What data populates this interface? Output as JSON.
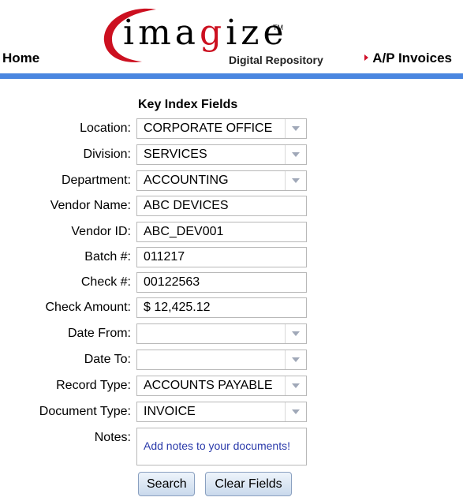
{
  "header": {
    "home": "Home",
    "logo_word_a": "ima",
    "logo_word_b": "g",
    "logo_word_c": "i",
    "logo_word_d": "ze",
    "logo_tm": "TM",
    "logo_subtitle": "Digital Repository",
    "ap_invoices": "A/P Invoices"
  },
  "colors": {
    "accent_bar": "#4a86e0",
    "logo_red": "#cc1020",
    "notes_text": "#2a3aaa"
  },
  "form": {
    "title": "Key Index Fields",
    "fields": [
      {
        "label": "Location:",
        "value": "CORPORATE OFFICE",
        "type": "select"
      },
      {
        "label": "Division:",
        "value": "SERVICES",
        "type": "select"
      },
      {
        "label": "Department:",
        "value": "ACCOUNTING",
        "type": "select"
      },
      {
        "label": "Vendor Name:",
        "value": "ABC DEVICES",
        "type": "text"
      },
      {
        "label": "Vendor ID:",
        "value": "ABC_DEV001",
        "type": "text"
      },
      {
        "label": "Batch #:",
        "value": "011217",
        "type": "text"
      },
      {
        "label": "Check #:",
        "value": "00122563",
        "type": "text"
      },
      {
        "label": "Check Amount:",
        "value": "$ 12,425.12",
        "type": "text"
      },
      {
        "label": "Date From:",
        "value": "",
        "type": "select"
      },
      {
        "label": "Date To:",
        "value": "",
        "type": "select"
      },
      {
        "label": "Record Type:",
        "value": "ACCOUNTS PAYABLE",
        "type": "select"
      },
      {
        "label": "Document Type:",
        "value": "INVOICE",
        "type": "select"
      }
    ],
    "notes_label": "Notes:",
    "notes_placeholder": "Add notes to your documents!",
    "search_label": "Search",
    "clear_label": "Clear Fields"
  }
}
